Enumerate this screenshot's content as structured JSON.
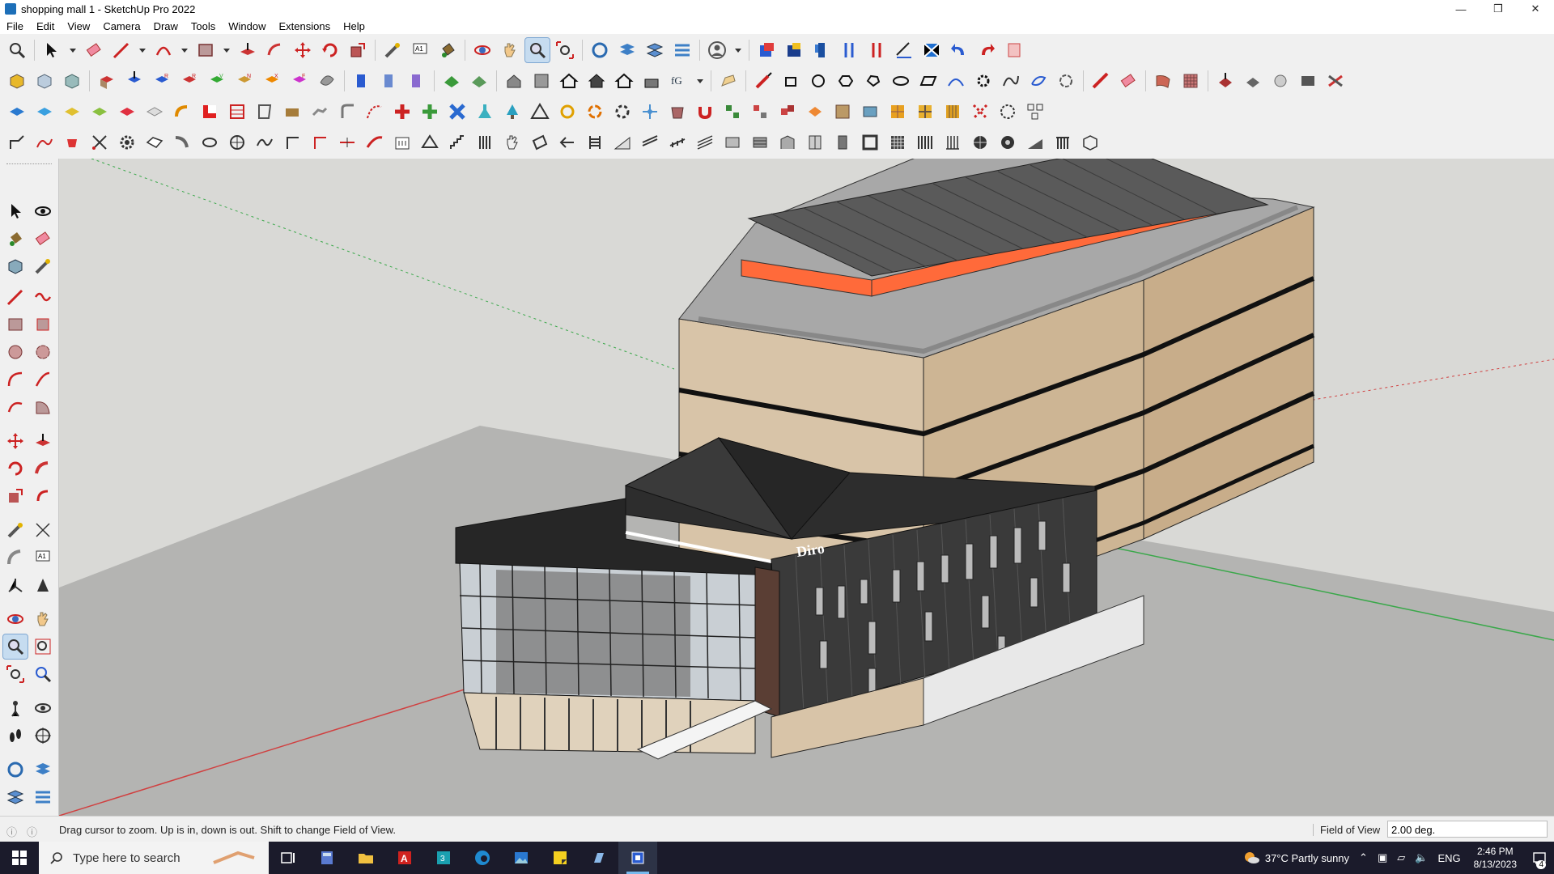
{
  "window": {
    "title": "shopping mall 1 - SketchUp Pro 2022",
    "minimize": "—",
    "restore": "❒",
    "close": "✕"
  },
  "menu": [
    "File",
    "Edit",
    "View",
    "Camera",
    "Draw",
    "Tools",
    "Window",
    "Extensions",
    "Help"
  ],
  "model": {
    "sign_text": "Diro"
  },
  "status": {
    "message": "Drag cursor to zoom.  Up is in, down is out. Shift to change Field of View.",
    "measurement_label": "Field of View",
    "measurement_value": "2.00 deg."
  },
  "taskbar": {
    "search_placeholder": "Type here to search",
    "weather": "37°C  Partly sunny",
    "language": "ENG",
    "time": "2:46 PM",
    "date": "8/13/2023",
    "notification_count": "4",
    "apps": [
      "task-view",
      "calculator",
      "file-explorer",
      "acrobat",
      "3ds-max",
      "edge",
      "photos",
      "sticky-notes",
      "layout",
      "sketchup"
    ]
  },
  "colors": {
    "accent": "#76b9ed",
    "roof_accent": "#ff6a3a",
    "axis_red": "#d04040",
    "axis_green": "#3aa84a"
  }
}
